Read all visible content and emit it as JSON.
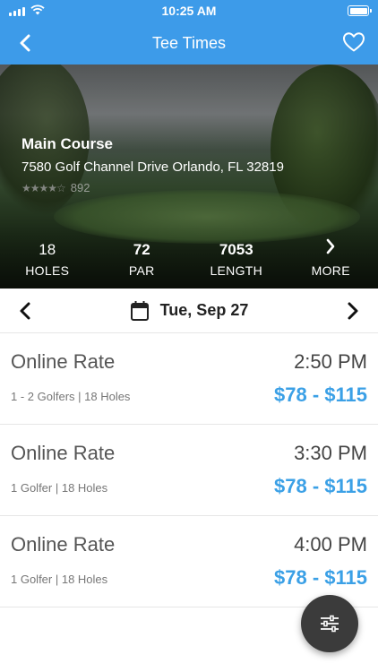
{
  "status_bar": {
    "time": "10:25 AM"
  },
  "nav": {
    "title": "Tee Times",
    "back_icon": "chevron-left-icon",
    "favorite_icon": "heart-icon"
  },
  "course": {
    "name": "Main Course",
    "address": "7580 Golf Channel Drive Orlando, FL 32819",
    "rating": 4.5,
    "review_count": "892"
  },
  "stats": [
    {
      "value": "18",
      "label": "HOLES"
    },
    {
      "value": "72",
      "label": "PAR"
    },
    {
      "value": "7053",
      "label": "LENGTH"
    },
    {
      "value": "",
      "label": "MORE"
    }
  ],
  "date_bar": {
    "date": "Tue, Sep 27",
    "prev_icon": "chevron-left-icon",
    "next_icon": "chevron-right-icon",
    "calendar_icon": "calendar-icon"
  },
  "tee_times": [
    {
      "title": "Online Rate",
      "time": "2:50 PM",
      "details": "1 - 2 Golfers | 18 Holes",
      "price": "$78 - $115"
    },
    {
      "title": "Online Rate",
      "time": "3:30 PM",
      "details": "1 Golfer | 18 Holes",
      "price": "$78 - $115"
    },
    {
      "title": "Online Rate",
      "time": "4:00 PM",
      "details": "1 Golfer | 18 Holes",
      "price": "$78 - $115"
    }
  ],
  "fab": {
    "icon": "filter-sliders-icon"
  },
  "colors": {
    "accent": "#3d9be9",
    "price": "#3ba0e6",
    "fab": "#3b3b3b"
  }
}
